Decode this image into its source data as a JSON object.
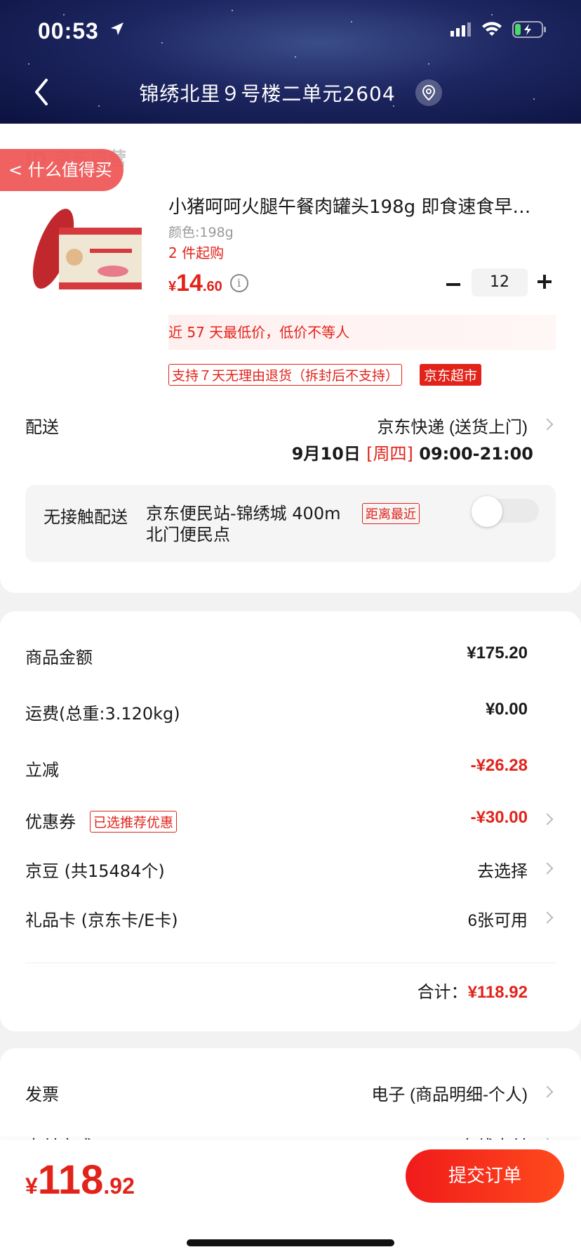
{
  "status_bar": {
    "time": "00:53"
  },
  "header": {
    "address": "锦绣北里９号楼二单元2604"
  },
  "colors": {
    "accent_red": "#e2231a",
    "header_bg": "#1d2660"
  },
  "product": {
    "store_label": "JD 京东自营",
    "worth_tag": "什么值得买",
    "title": "小猪呵呵火腿午餐肉罐头198g  即食速食早…",
    "color": "颜色:198g",
    "min_purchase": "2 件起购",
    "price_currency": "¥",
    "price_int": "14",
    "price_dec": ".60",
    "quantity": "12",
    "lowest_price_note": "近 57 天最低价，低价不等人",
    "return_policy_tag": "支持７天无理由退货（拆封后不支持）",
    "market_tag": "京东超市"
  },
  "delivery": {
    "label": "配送",
    "method": "京东快递 (送货上门)",
    "date": "9月10日",
    "weekday": "[周四]",
    "time": "09:00-21:00",
    "contactless_label": "无接触配送",
    "contactless_place": "京东便民站-锦绣城  400m 北门便民点",
    "contactless_tag": "距离最近"
  },
  "summary": {
    "goods_label": "商品金额",
    "goods_value": "¥175.20",
    "shipping_label": "运费(总重:3.120kg)",
    "shipping_value": "¥0.00",
    "discount_label": "立减",
    "discount_value": "-¥26.28",
    "coupon_label": "优惠券",
    "coupon_tag": "已选推荐优惠",
    "coupon_value": "-¥30.00",
    "jingdou_label": "京豆 (共15484个)",
    "jingdou_value": "去选择",
    "giftcard_label": "礼品卡 (京东卡/E卡)",
    "giftcard_value": "6张可用",
    "total_label": "合计：",
    "total_value": "¥118.92"
  },
  "invoice": {
    "label": "发票",
    "value": "电子 (商品明细-个人)",
    "payment_label": "支付方式",
    "payment_value": "在线支付"
  },
  "bottom": {
    "currency": "¥",
    "total_int": "118",
    "total_dec": ".92",
    "submit_label": "提交订单"
  }
}
